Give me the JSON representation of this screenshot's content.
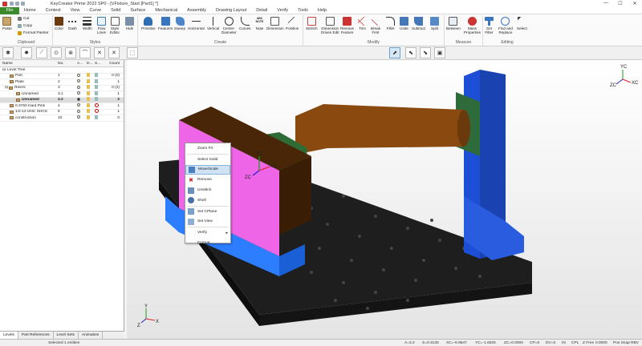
{
  "titlebar": {
    "title": "KeyCreator Prime 2022 SP0 - [VFixture_Start [Part1] *]",
    "minimize": "—",
    "maximize": "☐",
    "close": "✕"
  },
  "menu": [
    "File",
    "Home",
    "Context",
    "View",
    "Curve",
    "Solid",
    "Surface",
    "Mechanical",
    "Assembly",
    "Drawing Layout",
    "Detail",
    "Verify",
    "Tools",
    "Help"
  ],
  "ribbon": {
    "clipboard": {
      "paste": "Paste",
      "cut": "Cut",
      "copy": "Copy",
      "format_painter": "Format Painter",
      "group": "Clipboard"
    },
    "styles": {
      "color": "Color",
      "dash": "Dash",
      "width": "Width",
      "flow_lines": "Flow\nLines",
      "style_editor": "Style\nEditor",
      "hide": "Hide",
      "group": "Styles"
    },
    "create": {
      "primitive": "Primitive",
      "features": "Features",
      "sweep": "Sweep",
      "horizontal": "Horizontal",
      "vertical": "Vertical",
      "center_diameter": "Center-\nDiameter",
      "curves": "Curves",
      "note": "Note",
      "dimension": "Dimension",
      "position": "Position",
      "group": "Create"
    },
    "modify": {
      "stretch": "Stretch",
      "dimension_driven_edit": "Dimension\nDriven Edit",
      "remove_feature": "Remove\nFeature",
      "trim": "Trim",
      "break_first": "Break\nFirst",
      "fillet": "Fillet",
      "unite": "Unite",
      "subtract": "Subtract",
      "split": "Split",
      "group": "Modify"
    },
    "measure": {
      "between": "Between",
      "mass_properties": "Mass\nProperties",
      "group": "Measure"
    },
    "editing": {
      "set_filter": "Set\nFilter",
      "find_replace": "Find and\nReplace",
      "select": "Select",
      "group": "Editing"
    },
    "note_label": "ABC\nNOTE"
  },
  "level_tree": {
    "headers": {
      "name": "Name",
      "no": "No.",
      "a": "A...",
      "d": "D...",
      "s": "S...",
      "count": "Count"
    },
    "rows": [
      {
        "name": "Level Tree",
        "no": "",
        "count": ""
      },
      {
        "name": "Part",
        "no": "1",
        "count": "0 (0)"
      },
      {
        "name": "Plate",
        "no": "2",
        "count": "1"
      },
      {
        "name": "Risers",
        "no": "3",
        "count": "0 (2)"
      },
      {
        "name": "Unnamed",
        "no": "3.1",
        "count": "1"
      },
      {
        "name": "Unnamed",
        "no": "3.2",
        "count": "2"
      },
      {
        "name": "0.3750 Hard Pins",
        "no": "4",
        "count": "1"
      },
      {
        "name": "1/2-13 UNC SHCS",
        "no": "5",
        "count": "1"
      },
      {
        "name": "construction",
        "no": "10",
        "count": "0"
      }
    ],
    "tabs": [
      "Levels",
      "Part References",
      "Level Sets",
      "Animation"
    ]
  },
  "context_menu": {
    "items": [
      "Zoom Fit",
      "Select Solid",
      "Move/Scale",
      "Remove",
      "Unstitch",
      "Shell",
      "Set CPlane",
      "Set View",
      "Verify",
      "Format"
    ],
    "highlighted": "Move/Scale"
  },
  "axes": {
    "x": "X",
    "y": "Y",
    "z": "Z",
    "xc": "XC",
    "yc": "YC",
    "zc": "ZC"
  },
  "status": {
    "left": "Selected 1 entities",
    "a": "A=3.2",
    "s": "S=0.3130",
    "xc": "XC=-6.9647",
    "yc": "YC=-1.6025",
    "zc": "ZC=0.0000",
    "cp": "CP=0",
    "dv": "DV=0",
    "units": "IN",
    "cpl": "CPL",
    "zfree": "Z Free",
    "zfree_val": "0.0000",
    "possnap": "Pos Snap",
    "ribbon": "RBV"
  }
}
